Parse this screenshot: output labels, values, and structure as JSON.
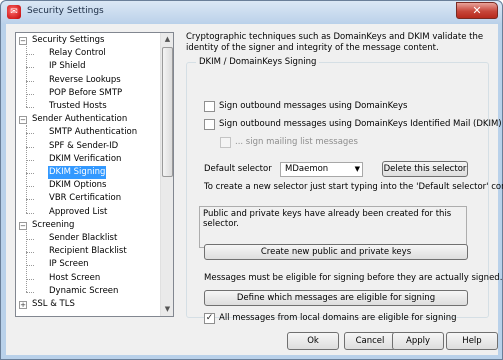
{
  "window": {
    "title": "Security Settings",
    "close_glyph": "✕"
  },
  "nav": {
    "items": [
      {
        "label": "Security Settings",
        "level": 0,
        "expander": "−"
      },
      {
        "label": "Relay Control",
        "level": 1
      },
      {
        "label": "IP Shield",
        "level": 1
      },
      {
        "label": "Reverse Lookups",
        "level": 1
      },
      {
        "label": "POP Before SMTP",
        "level": 1
      },
      {
        "label": "Trusted Hosts",
        "level": 1
      },
      {
        "label": "Sender Authentication",
        "level": 0,
        "expander": "−"
      },
      {
        "label": "SMTP Authentication",
        "level": 1
      },
      {
        "label": "SPF & Sender-ID",
        "level": 1
      },
      {
        "label": "DKIM Verification",
        "level": 1
      },
      {
        "label": "DKIM Signing",
        "level": 1,
        "selected": true
      },
      {
        "label": "DKIM Options",
        "level": 1
      },
      {
        "label": "VBR Certification",
        "level": 1
      },
      {
        "label": "Approved List",
        "level": 1
      },
      {
        "label": "Screening",
        "level": 0,
        "expander": "−"
      },
      {
        "label": "Sender Blacklist",
        "level": 1
      },
      {
        "label": "Recipient Blacklist",
        "level": 1
      },
      {
        "label": "IP Screen",
        "level": 1
      },
      {
        "label": "Host Screen",
        "level": 1
      },
      {
        "label": "Dynamic Screen",
        "level": 1
      },
      {
        "label": "SSL & TLS",
        "level": 0,
        "expander": "+"
      }
    ]
  },
  "main": {
    "description": "Cryptographic techniques such as DomainKeys and DKIM validate the identity of the signer and integrity of the message content.",
    "group_title": "DKIM / DomainKeys Signing",
    "sign_domainkeys": {
      "label": "Sign outbound messages using DomainKeys",
      "checked": false
    },
    "sign_dkim": {
      "label": "Sign outbound messages using DomainKeys Identified Mail (DKIM)",
      "checked": false
    },
    "sign_mailing_list": {
      "label": "... sign mailing list messages",
      "checked": false,
      "enabled": false
    },
    "default_selector_label": "Default selector",
    "default_selector_value": "MDaemon",
    "delete_selector_button": "Delete this selector",
    "new_selector_hint": "To create a new selector just start typing into the 'Default selector' control.",
    "keys_status": "Public and private keys have already been created for this selector.",
    "create_keys_button": "Create new public and private keys",
    "eligibility_note": "Messages must be eligible for signing before they are actually signed.",
    "define_eligible_button": "Define which messages are eligible for signing",
    "local_domains_eligible": {
      "label": "All messages from local domains are eligible for signing",
      "checked": true
    }
  },
  "footer": {
    "ok": "Ok",
    "cancel": "Cancel",
    "apply": "Apply",
    "help": "Help"
  }
}
